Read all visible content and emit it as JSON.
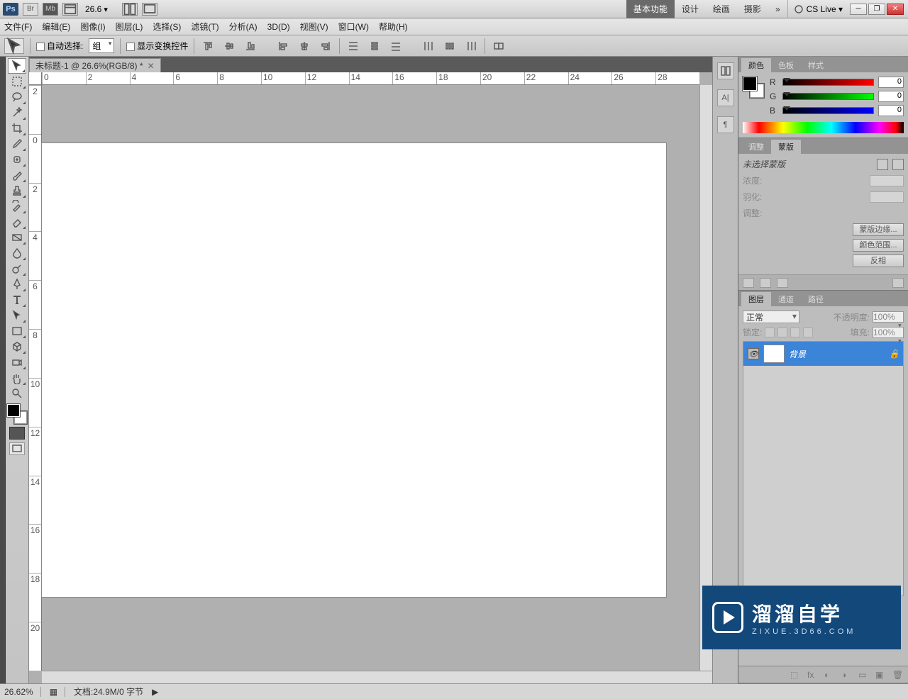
{
  "appbar": {
    "zoom": "26.6",
    "workspaces": [
      "基本功能",
      "设计",
      "绘画",
      "摄影"
    ],
    "more": "»",
    "cslive": "CS Live ▾"
  },
  "menu": [
    "文件(F)",
    "编辑(E)",
    "图像(I)",
    "图层(L)",
    "选择(S)",
    "滤镜(T)",
    "分析(A)",
    "3D(D)",
    "视图(V)",
    "窗口(W)",
    "帮助(H)"
  ],
  "options": {
    "autoselect": "自动选择:",
    "group": "组",
    "showtransform": "显示变换控件"
  },
  "doc": {
    "tab": "未标题-1 @ 26.6%(RGB/8) *",
    "rulerH": [
      "0",
      "2",
      "4",
      "6",
      "8",
      "10",
      "12",
      "14",
      "16",
      "18",
      "20",
      "22",
      "24",
      "26",
      "28"
    ],
    "rulerV": [
      "2",
      "0",
      "2",
      "4",
      "6",
      "8",
      "10",
      "12",
      "14",
      "16",
      "18",
      "20"
    ]
  },
  "colorPanel": {
    "tabs": [
      "颜色",
      "色板",
      "样式"
    ],
    "r": "0",
    "g": "0",
    "b": "0",
    "rl": "R",
    "gl": "G",
    "bl": "B"
  },
  "adjPanel": {
    "tabs": [
      "调整",
      "蒙版"
    ]
  },
  "maskPanel": {
    "none": "未选择蒙版",
    "density": "浓度:",
    "feather": "羽化:",
    "adjust": "调整:",
    "edge": "蒙版边缘...",
    "range": "颜色范围...",
    "invert": "反相"
  },
  "layersPanel": {
    "tabs": [
      "图层",
      "通道",
      "路径"
    ],
    "blend": "正常",
    "opacityL": "不透明度:",
    "opacity": "100%",
    "lockL": "锁定:",
    "fillL": "填充:",
    "fill": "100%",
    "bgLayer": "背景"
  },
  "status": {
    "zoom": "26.62%",
    "doc": "文档:24.9M/0 字节"
  },
  "watermark": {
    "big": "溜溜自学",
    "small": "ZIXUE.3D66.COM"
  }
}
